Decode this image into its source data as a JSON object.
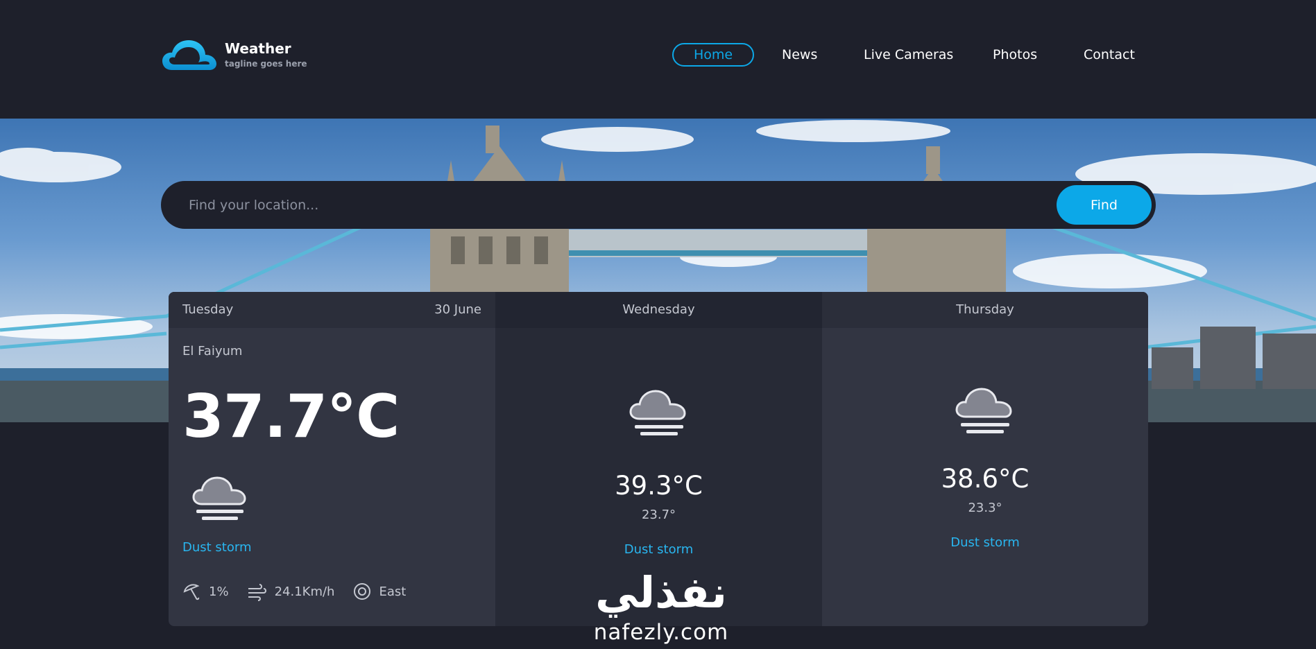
{
  "brand": {
    "name": "Weather",
    "tagline": "tagline goes here"
  },
  "nav": {
    "items": [
      {
        "label": "Home",
        "active": true
      },
      {
        "label": "News",
        "active": false
      },
      {
        "label": "Live Cameras",
        "active": false
      },
      {
        "label": "Photos",
        "active": false
      },
      {
        "label": "Contact",
        "active": false
      }
    ]
  },
  "search": {
    "placeholder": "Find your location...",
    "button_label": "Find"
  },
  "forecast": {
    "today": {
      "day": "Tuesday",
      "date": "30 June",
      "location": "El Faiyum",
      "temperature": "37.7°C",
      "condition": "Dust storm",
      "icon": "dust-cloud-icon",
      "rain": "1%",
      "wind_speed": "24.1Km/h",
      "wind_direction": "East"
    },
    "days": [
      {
        "day": "Wednesday",
        "max": "39.3°C",
        "min": "23.7°",
        "condition": "Dust storm",
        "icon": "dust-cloud-icon"
      },
      {
        "day": "Thursday",
        "max": "38.6°C",
        "min": "23.3°",
        "condition": "Dust storm",
        "icon": "dust-cloud-icon"
      }
    ]
  },
  "watermark": {
    "arabic": "نفذلي",
    "latin": "nafezly.com"
  },
  "colors": {
    "accent": "#0ca8e8",
    "background": "#1e202b",
    "panel": "#323542",
    "condition": "#29b6f0"
  }
}
